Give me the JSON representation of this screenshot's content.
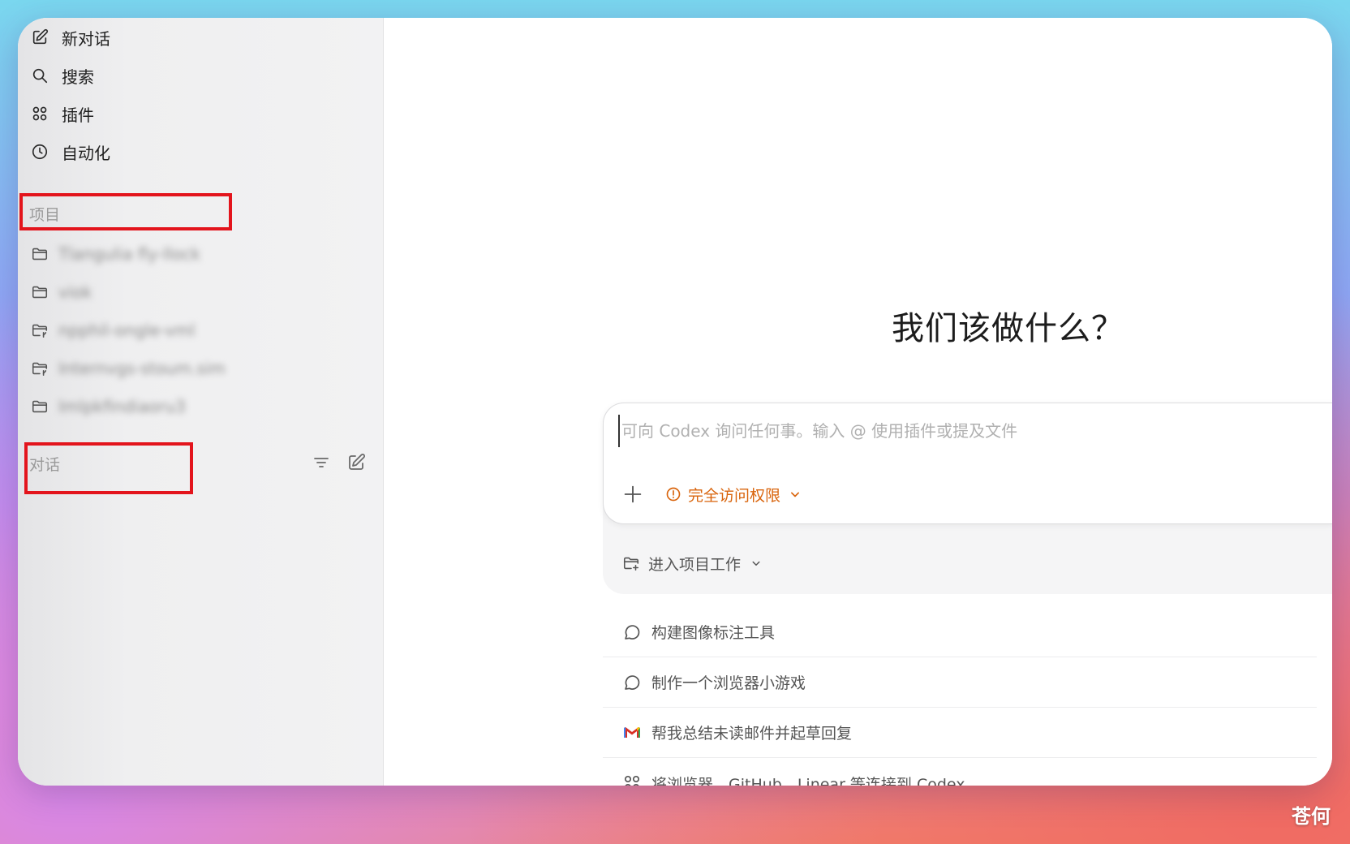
{
  "sidebar": {
    "nav": [
      {
        "label": "新对话",
        "icon": "compose-icon"
      },
      {
        "label": "搜索",
        "icon": "search-icon"
      },
      {
        "label": "插件",
        "icon": "plugins-icon"
      },
      {
        "label": "自动化",
        "icon": "clock-icon"
      }
    ],
    "projects_label": "项目",
    "projects": [
      {
        "name": "Tlangulia fly-llock",
        "icon": "folder-icon"
      },
      {
        "name": "viok",
        "icon": "folder-icon"
      },
      {
        "name": "npphil-ongle-vml",
        "icon": "folder-git-icon"
      },
      {
        "name": "Internvgs-stoum.sim",
        "icon": "folder-git-icon"
      },
      {
        "name": "Imlpkfindiaoru3",
        "icon": "folder-icon"
      }
    ],
    "conversations_label": "对话"
  },
  "main": {
    "headline": "我们该做什么？",
    "composer": {
      "placeholder": "可向 Codex 询问任何事。输入 @ 使用插件或提及文件",
      "access_label": "完全访问权限",
      "project_label": "进入项目工作"
    },
    "suggestions": [
      {
        "label": "构建图像标注工具",
        "icon": "chat-bubble-icon"
      },
      {
        "label": "制作一个浏览器小游戏",
        "icon": "chat-bubble-icon"
      },
      {
        "label": "帮我总结未读邮件并起草回复",
        "icon": "gmail-icon"
      },
      {
        "label": "将浏览器、GitHub、Linear 等连接到 Codex",
        "icon": "plugins-icon"
      }
    ]
  },
  "watermark": "苍何",
  "colors": {
    "accent_orange": "#d9640c",
    "highlight_red": "#e3141c"
  }
}
